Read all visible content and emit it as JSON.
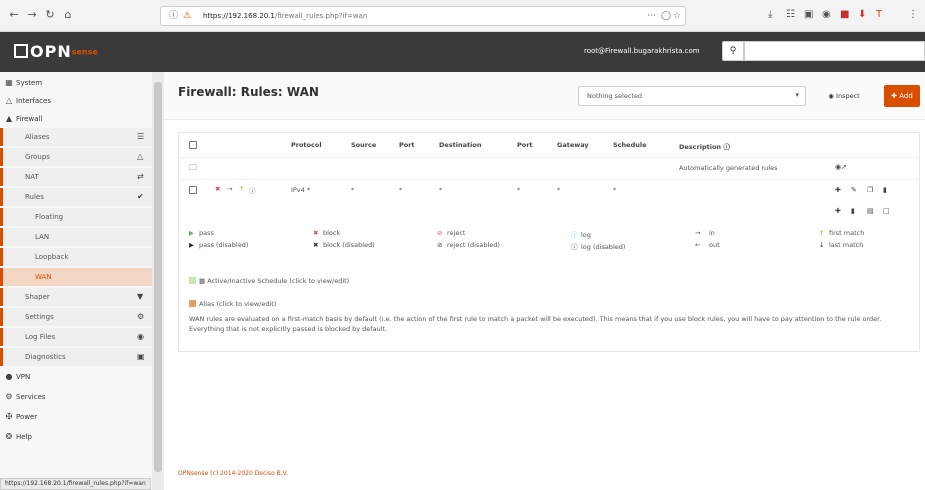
{
  "browser": {
    "url_host": "https://192.168.20.1",
    "url_path": "/firewall_rules.php?if=wan",
    "status_url": "https://192.168.20.1/firewall_rules.php?if=wan"
  },
  "topnav": {
    "brand": "OPN",
    "brand_suffix": "sense",
    "user": "root@Firewall.bugarakhrista.com"
  },
  "sidebar": {
    "items": [
      {
        "label": "System",
        "icon": "grid-icon"
      },
      {
        "label": "Interfaces",
        "icon": "sitemap-icon"
      },
      {
        "label": "Firewall",
        "icon": "fire-icon"
      },
      {
        "label": "Aliases",
        "icon": "list-icon"
      },
      {
        "label": "Groups",
        "icon": "sitemap-icon"
      },
      {
        "label": "NAT",
        "icon": "exchange-icon"
      },
      {
        "label": "Rules",
        "icon": "check-icon"
      },
      {
        "label": "Floating"
      },
      {
        "label": "LAN"
      },
      {
        "label": "Loopback"
      },
      {
        "label": "WAN"
      },
      {
        "label": "Shaper",
        "icon": "filter-icon"
      },
      {
        "label": "Settings",
        "icon": "cogs-icon"
      },
      {
        "label": "Log Files",
        "icon": "eye-icon"
      },
      {
        "label": "Diagnostics",
        "icon": "medkit-icon"
      },
      {
        "label": "VPN",
        "icon": "globe-icon"
      },
      {
        "label": "Services",
        "icon": "cog-icon"
      },
      {
        "label": "Power",
        "icon": "plug-icon"
      },
      {
        "label": "Help",
        "icon": "support-icon"
      }
    ]
  },
  "page": {
    "title": "Firewall: Rules: WAN",
    "select_value": "Nothing selected",
    "inspect_label": "Inspect",
    "add_label": "Add"
  },
  "table": {
    "headers": {
      "protocol": "Protocol",
      "source": "Source",
      "port": "Port",
      "destination": "Destination",
      "port2": "Port",
      "gateway": "Gateway",
      "schedule": "Schedule",
      "description": "Description"
    },
    "auto_rules_label": "Automatically generated rules",
    "rule": {
      "protocol": "IPv4 *",
      "source": "*",
      "port": "*",
      "destination": "*",
      "port2": "*",
      "gateway": "*",
      "schedule": "*"
    }
  },
  "legend": {
    "pass": "pass",
    "pass_disabled": "pass (disabled)",
    "block": "block",
    "block_disabled": "block (disabled)",
    "reject": "reject",
    "reject_disabled": "reject (disabled)",
    "log": "log",
    "log_disabled": "log (disabled)",
    "in": "in",
    "out": "out",
    "first_match": "first match",
    "last_match": "last match"
  },
  "schedule_note": "Active/Inactive Schedule (click to view/edit)",
  "alias_note": "Alias (click to view/edit)",
  "help_text": "WAN rules are evaluated on a first-match basis by default (i.e. the action of the first rule to match a packet will be executed). This means that if you use block rules, you will have to pay attention to the rule order. Everything that is not explicitly passed is blocked by default.",
  "footer": "OPNsense (c) 2014-2020 Deciso B.V.",
  "colors": {
    "accent": "#d94f00",
    "navbar": "#3a3a3a",
    "pass": "#5cb85c",
    "block": "#d9534f"
  }
}
